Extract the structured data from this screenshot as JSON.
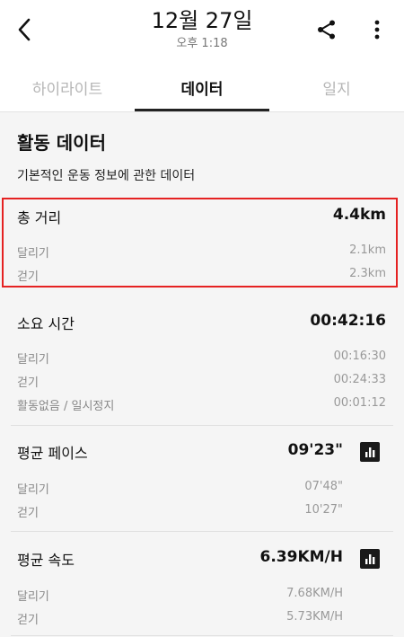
{
  "header": {
    "date": "12월 27일",
    "time": "오후 1:18"
  },
  "tabs": [
    {
      "label": "하이라이트",
      "active": false
    },
    {
      "label": "데이터",
      "active": true
    },
    {
      "label": "일지",
      "active": false
    }
  ],
  "section": {
    "title": "활동 데이터",
    "subtitle": "기본적인 운동 정보에 관한 데이터"
  },
  "distance": {
    "label": "총 거리",
    "value": "4.4km",
    "rows": [
      {
        "label": "달리기",
        "value": "2.1km"
      },
      {
        "label": "걷기",
        "value": "2.3km"
      }
    ]
  },
  "duration": {
    "label": "소요 시간",
    "value": "00:42:16",
    "rows": [
      {
        "label": "달리기",
        "value": "00:16:30"
      },
      {
        "label": "걷기",
        "value": "00:24:33"
      },
      {
        "label": "활동없음 / 일시정지",
        "value": "00:01:12"
      }
    ]
  },
  "pace": {
    "label": "평균 페이스",
    "value": "09'23\"",
    "rows": [
      {
        "label": "달리기",
        "value": "07'48\""
      },
      {
        "label": "걷기",
        "value": "10'27\""
      }
    ]
  },
  "speed": {
    "label": "평균 속도",
    "value": "6.39KM/H",
    "rows": [
      {
        "label": "달리기",
        "value": "7.68KM/H"
      },
      {
        "label": "걷기",
        "value": "5.73KM/H"
      }
    ]
  },
  "colors": {
    "highlight": "#e52222",
    "background": "#f5f5f5",
    "active_tab": "#222222"
  },
  "icons": [
    "back-arrow-icon",
    "share-icon",
    "more-vertical-icon",
    "bar-chart-icon"
  ]
}
